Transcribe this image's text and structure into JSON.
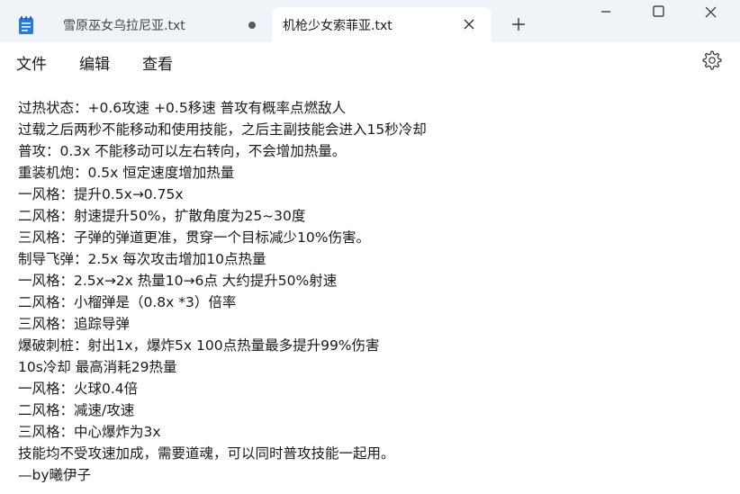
{
  "tabs": [
    {
      "title": "雪原巫女乌拉尼亚.txt",
      "state": "unsaved",
      "active": false
    },
    {
      "title": "机枪少女索菲亚.txt",
      "state": "open",
      "active": true
    }
  ],
  "menu": {
    "file": "文件",
    "edit": "编辑",
    "view": "查看"
  },
  "icons": {
    "tab": "notepad-icon",
    "unsaved": "unsaved-dot-icon",
    "close": "close-icon",
    "new_tab": "plus-icon",
    "minimize": "minimize-icon",
    "maximize": "maximize-icon",
    "window_close": "window-close-icon",
    "settings": "gear-icon"
  },
  "colors": {
    "titlebar": "#eff4f8",
    "active_tab": "#ffffff",
    "text": "#1a1a1a",
    "notepad_blue": "#2b7bd4"
  },
  "content": {
    "lines": [
      "过热状态：+0.6攻速 +0.5移速 普攻有概率点燃敌人",
      "过载之后两秒不能移动和使用技能，之后主副技能会进入15秒冷却",
      "普攻：0.3x 不能移动可以左右转向，不会增加热量。",
      "重装机炮：0.5x 恒定速度增加热量",
      "一风格：提升0.5x→0.75x",
      "二风格：射速提升50%，扩散角度为25~30度",
      "三风格：子弹的弹道更准，贯穿一个目标减少10%伤害。",
      "制导飞弹：2.5x 每次攻击增加10点热量",
      "一风格：2.5x→2x 热量10→6点 大约提升50%射速",
      "二风格：小榴弹是（0.8x *3）倍率",
      "三风格：追踪导弹",
      "爆破刺桩：射出1x，爆炸5x 100点热量最多提升99%伤害",
      "10s冷却 最高消耗29热量",
      "一风格：火球0.4倍",
      "二风格：减速/攻速",
      "三风格：中心爆炸为3x",
      "技能均不受攻速加成，需要道魂，可以同时普攻技能一起用。",
      "—by曦伊子"
    ]
  }
}
